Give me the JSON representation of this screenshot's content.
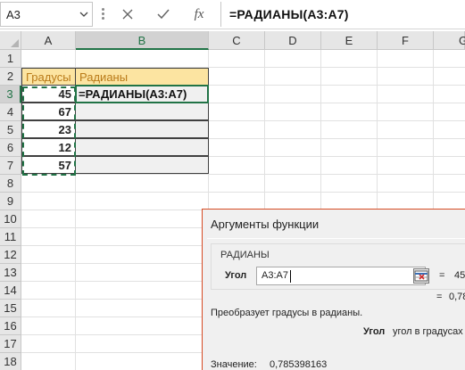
{
  "formula_bar": {
    "name_box": "A3",
    "fx_label": "fx",
    "formula": "=РАДИАНЫ(A3:A7)"
  },
  "columns": [
    "A",
    "B",
    "C",
    "D",
    "E",
    "F",
    "G"
  ],
  "rows": [
    "1",
    "2",
    "3",
    "4",
    "5",
    "6",
    "7",
    "8",
    "9",
    "10",
    "11",
    "12",
    "13",
    "14",
    "15",
    "16",
    "17",
    "18"
  ],
  "sheet": {
    "header_a": "Градусы",
    "header_b": "Радианы",
    "degrees": [
      "45",
      "67",
      "23",
      "12",
      "57"
    ],
    "formula_cell": "=РАДИАНЫ(A3:A7)"
  },
  "dialog": {
    "title": "Аргументы функции",
    "function_name": "РАДИАНЫ",
    "arg_label": "Угол",
    "arg_value": "A3:A7",
    "eq": "=",
    "arg_result": "45",
    "func_result": "0,78",
    "description": "Преобразует градусы в радианы.",
    "arg_name": "Угол",
    "arg_description": "угол в градусах",
    "value_label": "Значение:",
    "value": "0,785398163"
  }
}
